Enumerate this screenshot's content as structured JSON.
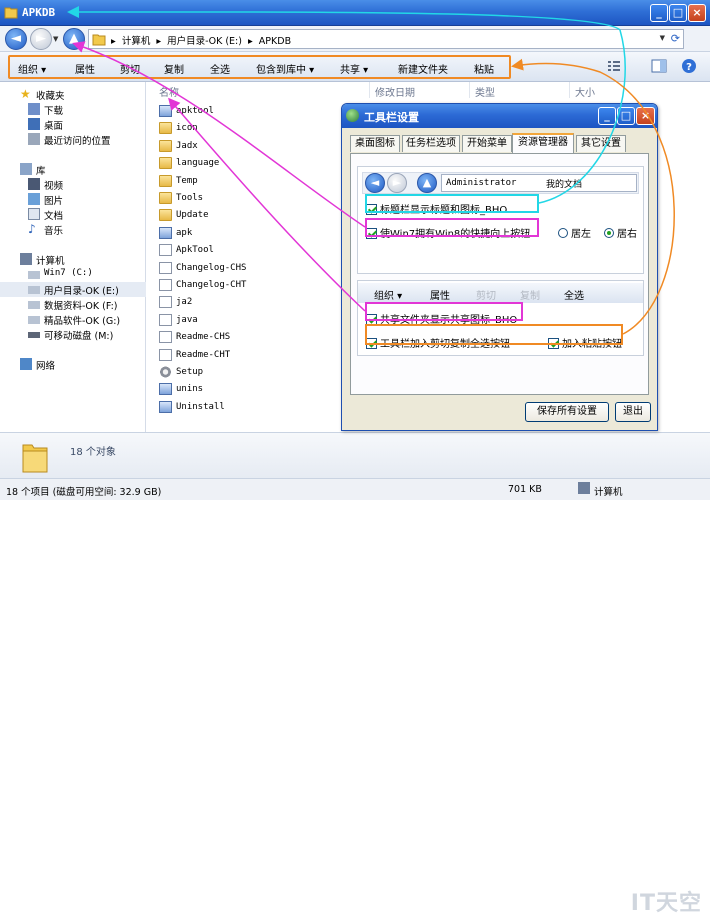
{
  "window": {
    "title": "APKDB",
    "controls": {
      "minimize": "_",
      "maximize": "□",
      "close": "×"
    }
  },
  "address": {
    "crumbs": [
      "计算机",
      "用户目录-OK (E:)",
      "APKDB"
    ],
    "separator": "▸"
  },
  "toolbar": {
    "items": [
      "组织 ▾",
      "属性",
      "剪切",
      "复制",
      "全选",
      "包含到库中 ▾",
      "共享 ▾",
      "新建文件夹",
      "粘贴"
    ],
    "highlight_color": "#f08a24"
  },
  "nav": {
    "favorites": {
      "label": "收藏夹",
      "items": [
        "下载",
        "桌面",
        "最近访问的位置"
      ]
    },
    "libraries": {
      "label": "库",
      "items": [
        "视频",
        "图片",
        "文档",
        "音乐"
      ]
    },
    "computer": {
      "label": "计算机",
      "items": [
        "Win7 (C:)",
        "用户目录-OK (E:)",
        "数据资料-OK (F:)",
        "精品软件-OK (G:)",
        "可移动磁盘 (M:)"
      ],
      "selected": "用户目录-OK (E:)"
    },
    "network": {
      "label": "网络"
    }
  },
  "columns": [
    "名称",
    "修改日期",
    "类型",
    "大小"
  ],
  "files": [
    {
      "name": "apktool",
      "icon": "app"
    },
    {
      "name": "icon",
      "icon": "folder"
    },
    {
      "name": "Jadx",
      "icon": "folder"
    },
    {
      "name": "language",
      "icon": "folder"
    },
    {
      "name": "Temp",
      "icon": "folder"
    },
    {
      "name": "Tools",
      "icon": "folder"
    },
    {
      "name": "Update",
      "icon": "folder"
    },
    {
      "name": "apk",
      "icon": "app"
    },
    {
      "name": "ApkTool",
      "icon": "doc"
    },
    {
      "name": "Changelog-CHS",
      "icon": "doc"
    },
    {
      "name": "Changelog-CHT",
      "icon": "doc"
    },
    {
      "name": "ja2",
      "icon": "doc"
    },
    {
      "name": "java",
      "icon": "doc"
    },
    {
      "name": "Readme-CHS",
      "icon": "doc"
    },
    {
      "name": "Readme-CHT",
      "icon": "doc"
    },
    {
      "name": "Setup",
      "icon": "gear"
    },
    {
      "name": "unins",
      "icon": "app"
    },
    {
      "name": "Uninstall",
      "icon": "app"
    }
  ],
  "details": {
    "count_text": "18 个对象"
  },
  "status": {
    "left": "18 个项目 (磁盘可用空间: 32.9 GB)",
    "size": "701 KB",
    "location": "计算机"
  },
  "dialog": {
    "title": "工具栏设置",
    "tabs": [
      "桌面图标",
      "任务栏选项",
      "开始菜单",
      "资源管理器",
      "其它设置"
    ],
    "active_tab": "资源管理器",
    "preview_crumbs": [
      "Administrator",
      "我的文档"
    ],
    "options": {
      "show_title_icon": "标题栏显示标题和图标_BHO",
      "win7_up_button": "使Win7拥有Win8的快捷向上按钮",
      "left": "居左",
      "right": "居右",
      "share_folder_icon": "共享文件夹显示共享图标_BHO",
      "cut_copy_selectall": "工具栏加入剪切复制全选按钮",
      "paste_button": "加入粘贴按钮"
    },
    "preview_toolbar": [
      "组织 ▾",
      "属性",
      "剪切",
      "复制",
      "全选"
    ],
    "buttons": {
      "save": "保存所有设置",
      "exit": "退出"
    }
  },
  "watermark": "IT天空"
}
